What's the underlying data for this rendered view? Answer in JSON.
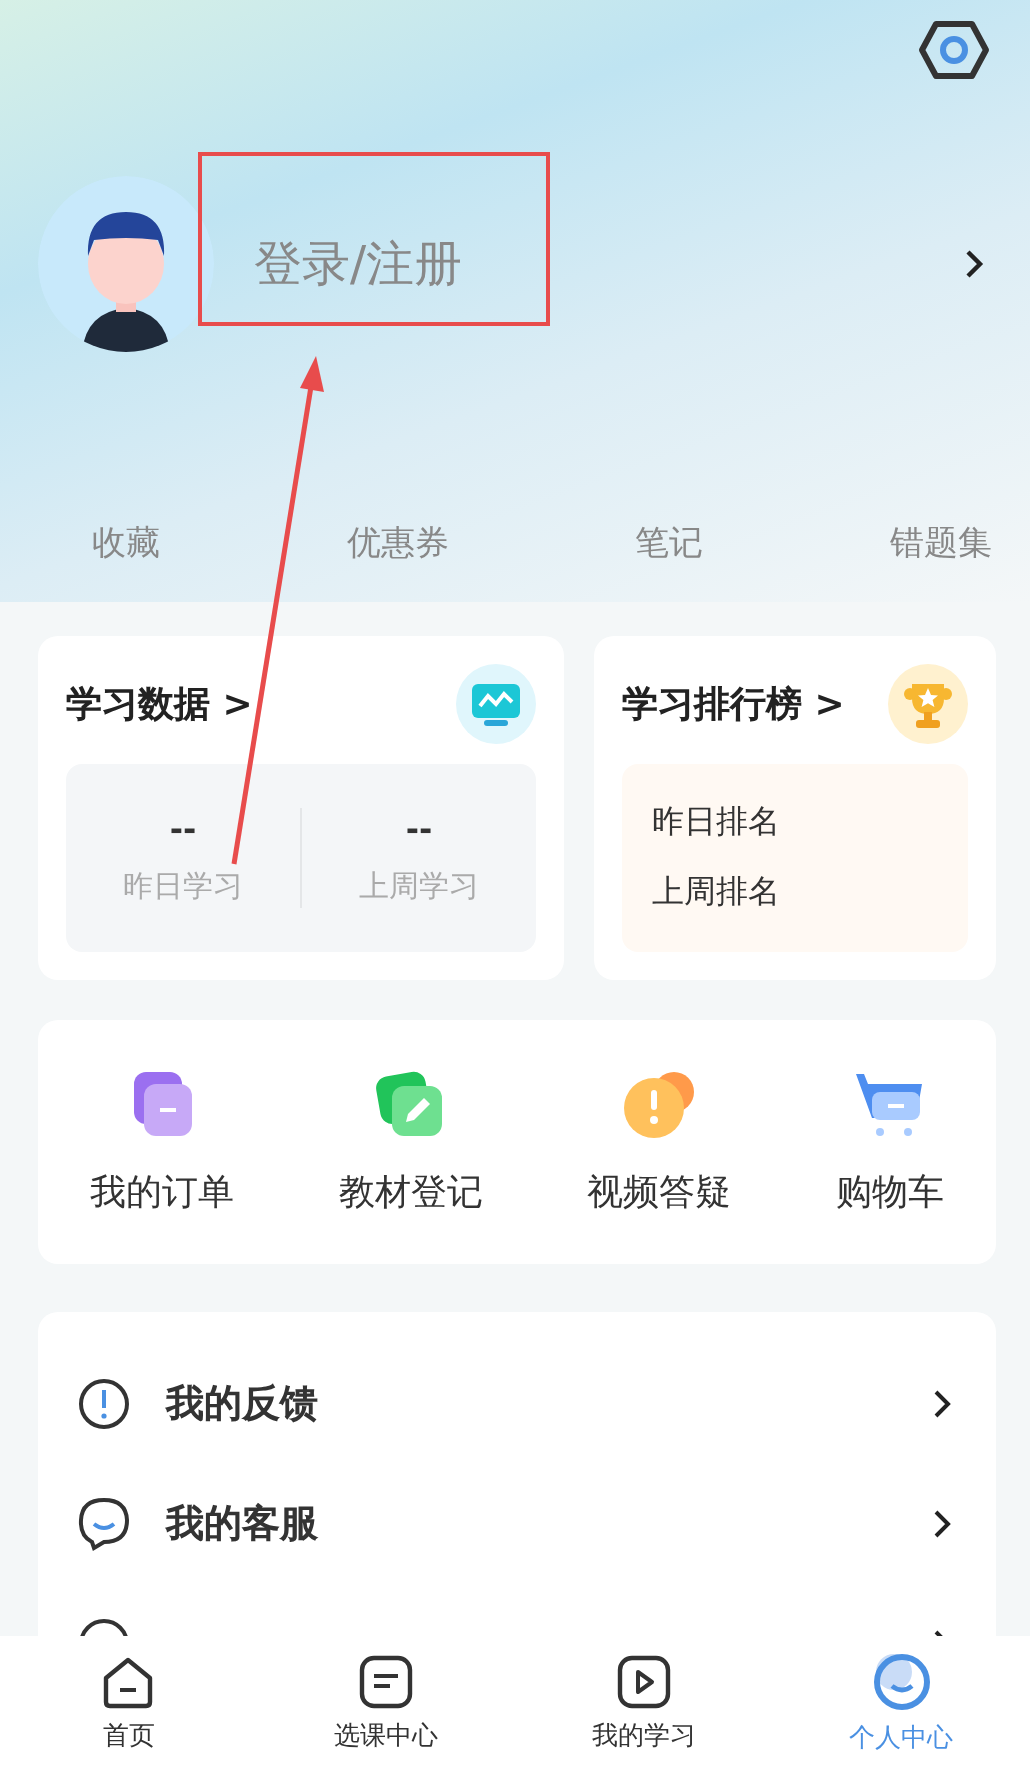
{
  "profile": {
    "login_label": "登录/注册"
  },
  "shortcuts": [
    "收藏",
    "优惠券",
    "笔记",
    "错题集"
  ],
  "study_data": {
    "title": "学习数据 >",
    "stats": [
      {
        "value": "--",
        "label": "昨日学习"
      },
      {
        "value": "--",
        "label": "上周学习"
      }
    ]
  },
  "leaderboard": {
    "title": "学习排行榜 >",
    "rows": [
      "昨日排名",
      "上周排名"
    ]
  },
  "services": [
    {
      "kind": "order",
      "label": "我的订单"
    },
    {
      "kind": "textbook",
      "label": "教材登记"
    },
    {
      "kind": "question",
      "label": "视频答疑"
    },
    {
      "kind": "cart",
      "label": "购物车"
    }
  ],
  "menu": [
    {
      "kind": "feedback",
      "label": "我的反馈"
    },
    {
      "kind": "service",
      "label": "我的客服"
    },
    {
      "kind": "address"
    }
  ],
  "tabs": [
    {
      "kind": "home",
      "label": "首页",
      "selected": false
    },
    {
      "kind": "courses",
      "label": "选课中心",
      "selected": false
    },
    {
      "kind": "study",
      "label": "我的学习",
      "selected": false
    },
    {
      "kind": "me",
      "label": "个人中心",
      "selected": true
    }
  ]
}
